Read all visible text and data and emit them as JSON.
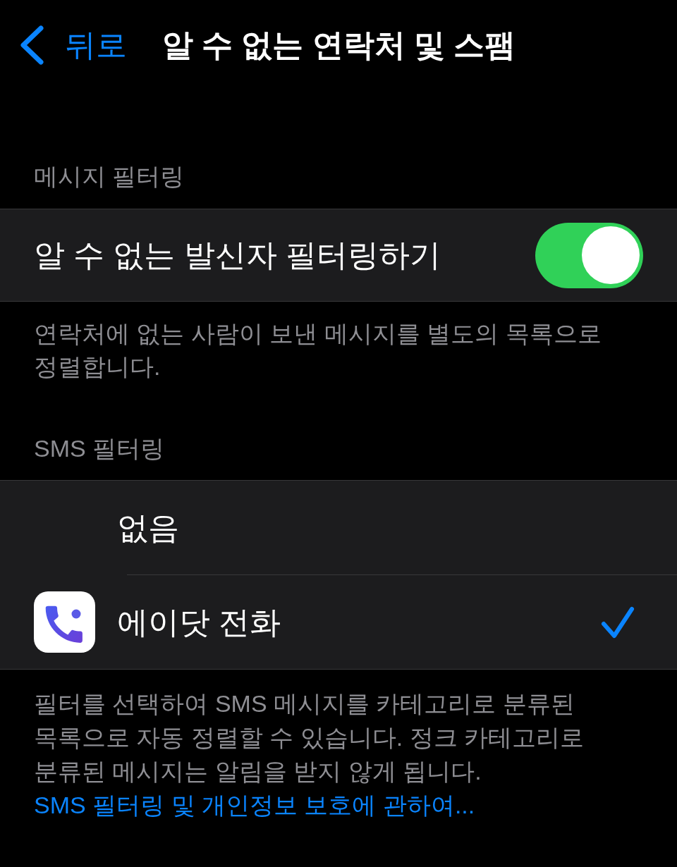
{
  "nav": {
    "back_label": "뒤로",
    "title": "알 수 없는 연락처 및 스팸"
  },
  "message_filtering": {
    "header": "메시지 필터링",
    "toggle": {
      "label": "알 수 없는 발신자 필터링하기",
      "on": true
    },
    "footer": "연락처에 없는 사람이 보낸 메시지를 별도의 목록으로 정렬합니다."
  },
  "sms_filtering": {
    "header": "SMS 필터링",
    "options": [
      {
        "kind": "plain",
        "label": "없음",
        "selected": false
      },
      {
        "kind": "app",
        "label": "에이닷 전화",
        "selected": true
      }
    ],
    "footer": "필터를 선택하여 SMS 메시지를 카테고리로 분류된 목록으로 자동 정렬할 수 있습니다. 정크 카테고리로 분류된 메시지는 알림을 받지 않게 됩니다.",
    "link": "SMS 필터링 및 개인정보 보호에 관하여..."
  }
}
